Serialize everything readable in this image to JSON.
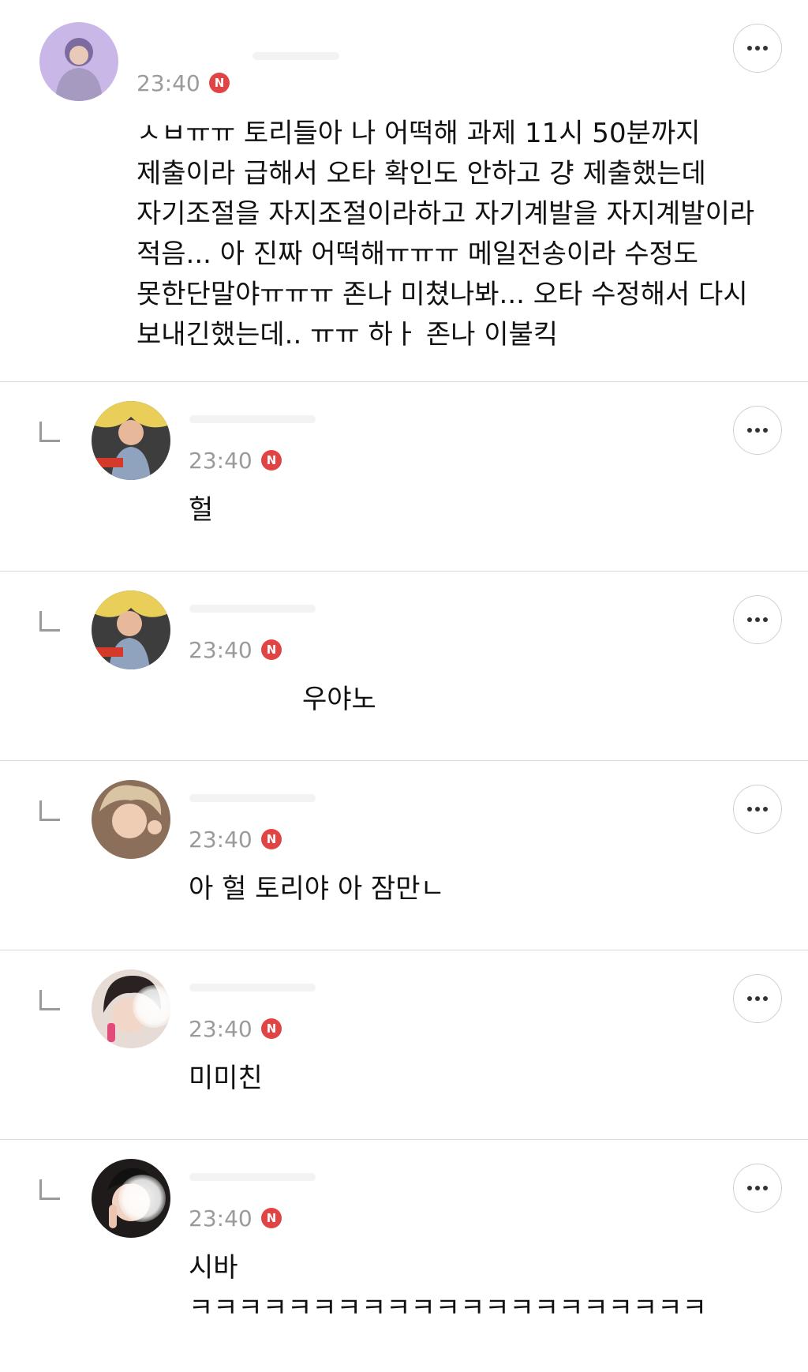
{
  "comments": [
    {
      "time": "23:40",
      "badge": "N",
      "text": "ㅅㅂㅠㅠ 토리들아 나 어떡해 과제 11시 50분까지 제출이라 급해서 오타 확인도 안하고 걍 제출했는데 자기조절을 자지조절이라하고 자기계발을 자지계발이라 적음... 아 진짜 어떡해ㅠㅠㅠ 메일전송이라 수정도 못한단말야ㅠㅠㅠ 존나 미쳤나봐... 오타 수정해서 다시 보내긴했는데.. ㅠㅠ 하ㅏ 존나 이불킥"
    },
    {
      "time": "23:40",
      "badge": "N",
      "text": "헐"
    },
    {
      "time": "23:40",
      "badge": "N",
      "text": "우야노"
    },
    {
      "time": "23:40",
      "badge": "N",
      "text": "아 헐 토리야 아 잠만ㄴ"
    },
    {
      "time": "23:40",
      "badge": "N",
      "text": "미미친"
    },
    {
      "time": "23:40",
      "badge": "N",
      "text": "시바 ㅋㅋㅋㅋㅋㅋㅋㅋㅋㅋㅋㅋㅋㅋㅋㅋㅋㅋㅋㅋㅋ"
    }
  ],
  "icons": {
    "more": "more-horizontal-icon",
    "reply": "reply-arrow-icon",
    "badge": "new-badge-icon"
  },
  "colors": {
    "badge": "#e04444",
    "timestamp": "#9b9b9b",
    "divider": "#d9d9d9"
  }
}
